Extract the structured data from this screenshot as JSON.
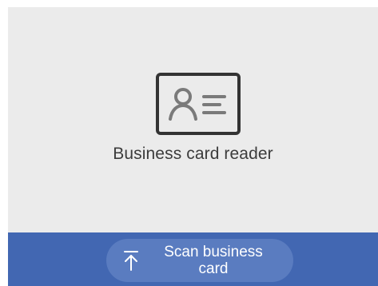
{
  "card": {
    "title": "Business card reader",
    "icon": "contact-card-icon"
  },
  "footer": {
    "scan_button_label": "Scan business card",
    "scan_button_icon": "upload-arrow-icon"
  },
  "colors": {
    "card_background": "#ebebeb",
    "footer_background": "#4267b2",
    "button_background": "#5a7cc0",
    "title_text": "#3c3c3c",
    "icon_stroke": "#333333",
    "icon_detail": "#7a7a7a"
  }
}
